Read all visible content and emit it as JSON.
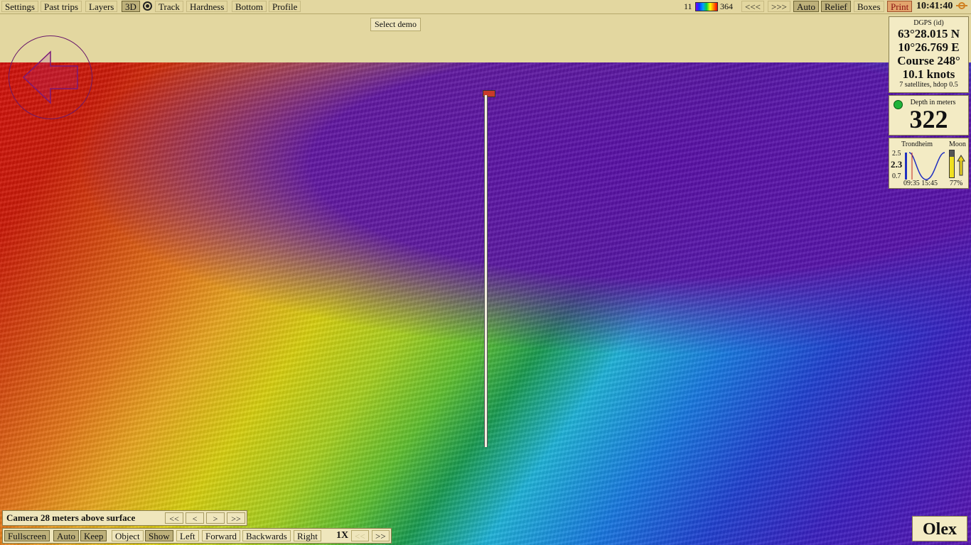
{
  "toolbar": {
    "left": [
      "Settings",
      "Past trips",
      "Layers",
      "3D",
      "Track",
      "Hardness",
      "Bottom",
      "Profile"
    ],
    "scale_min": "11",
    "scale_max": "364",
    "nav_back": "<<<",
    "nav_forward": ">>>",
    "auto": "Auto",
    "relief": "Relief",
    "boxes": "Boxes",
    "print": "Print",
    "time": "10:41:40"
  },
  "overlay": {
    "select_demo": "Select demo"
  },
  "gps": {
    "source": "DGPS (id)",
    "lat": "63°28.015 N",
    "lon": "10°26.769 E",
    "course": "Course 248°",
    "speed": "10.1 knots",
    "satellites": "7 satellites, hdop 0.5"
  },
  "depth": {
    "label": "Depth in meters",
    "value": "322"
  },
  "tide": {
    "place": "Trondheim",
    "moon_label": "Moon",
    "high": "2.5",
    "current": "2.3",
    "low": "0.7",
    "times": "09:35 15:45",
    "moon_pct": "77%"
  },
  "camera": {
    "text": "Camera 28 meters above surface",
    "btns": [
      "<<",
      "<",
      ">",
      ">>"
    ]
  },
  "bottom": {
    "fullscreen": "Fullscreen",
    "auto": "Auto",
    "keep": "Keep",
    "object": "Object",
    "show": "Show",
    "left": "Left",
    "forward": "Forward",
    "backwards": "Backwards",
    "right": "Right",
    "speed": "1X",
    "slower": "<<",
    "faster": ">>"
  },
  "brand": "Olex",
  "colors": {
    "panel_bg": "#f3ebc4",
    "toolbar_bg": "#e3d7a0",
    "print_bg": "#e2a46c",
    "depth_dot": "#1fb33a"
  },
  "icons": {
    "compass": "compass-arrow-icon",
    "sun": "sun-icon",
    "color_scale": "depth-color-scale-icon"
  }
}
